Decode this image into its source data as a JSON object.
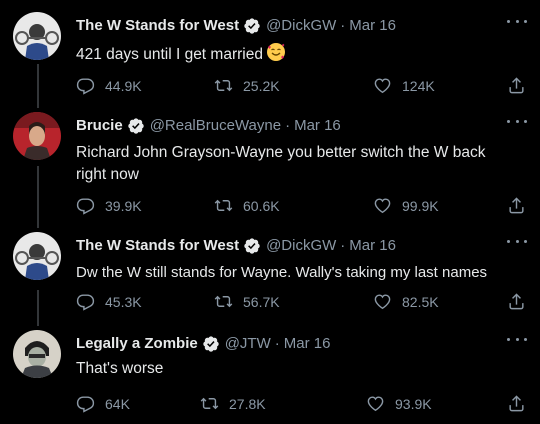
{
  "tweets": [
    {
      "name": "The W Stands for West",
      "handle": "@DickGW",
      "dot": "·",
      "date": "Mar 16",
      "text": "421 days until I get married",
      "emoji": "smiling-face-with-hearts",
      "replies": "44.9K",
      "retweets": "25.2K",
      "likes": "124K"
    },
    {
      "name": "Brucie",
      "handle": "@RealBruceWayne",
      "dot": "·",
      "date": "Mar 16",
      "text": "Richard John Grayson-Wayne you better switch the W back right now",
      "replies": "39.9K",
      "retweets": "60.6K",
      "likes": "99.9K"
    },
    {
      "name": "The W Stands for West",
      "handle": "@DickGW",
      "dot": "·",
      "date": "Mar 16",
      "text": "Dw the W still stands for Wayne. Wally's taking my last names",
      "replies": "45.3K",
      "retweets": "56.7K",
      "likes": "82.5K"
    },
    {
      "name": "Legally a Zombie",
      "handle": "@JTW",
      "dot": "·",
      "date": "Mar 16",
      "text": "That's worse",
      "replies": "64K",
      "retweets": "27.8K",
      "likes": "93.9K"
    }
  ],
  "colors": {
    "background": "#000000",
    "text": "#e7e9ea",
    "secondary": "#8b98a5",
    "verified": "#1d9bf0",
    "thread_line": "#333639"
  },
  "icons": [
    "verified-badge-icon",
    "more-icon",
    "reply-icon",
    "retweet-icon",
    "like-icon",
    "share-icon"
  ]
}
